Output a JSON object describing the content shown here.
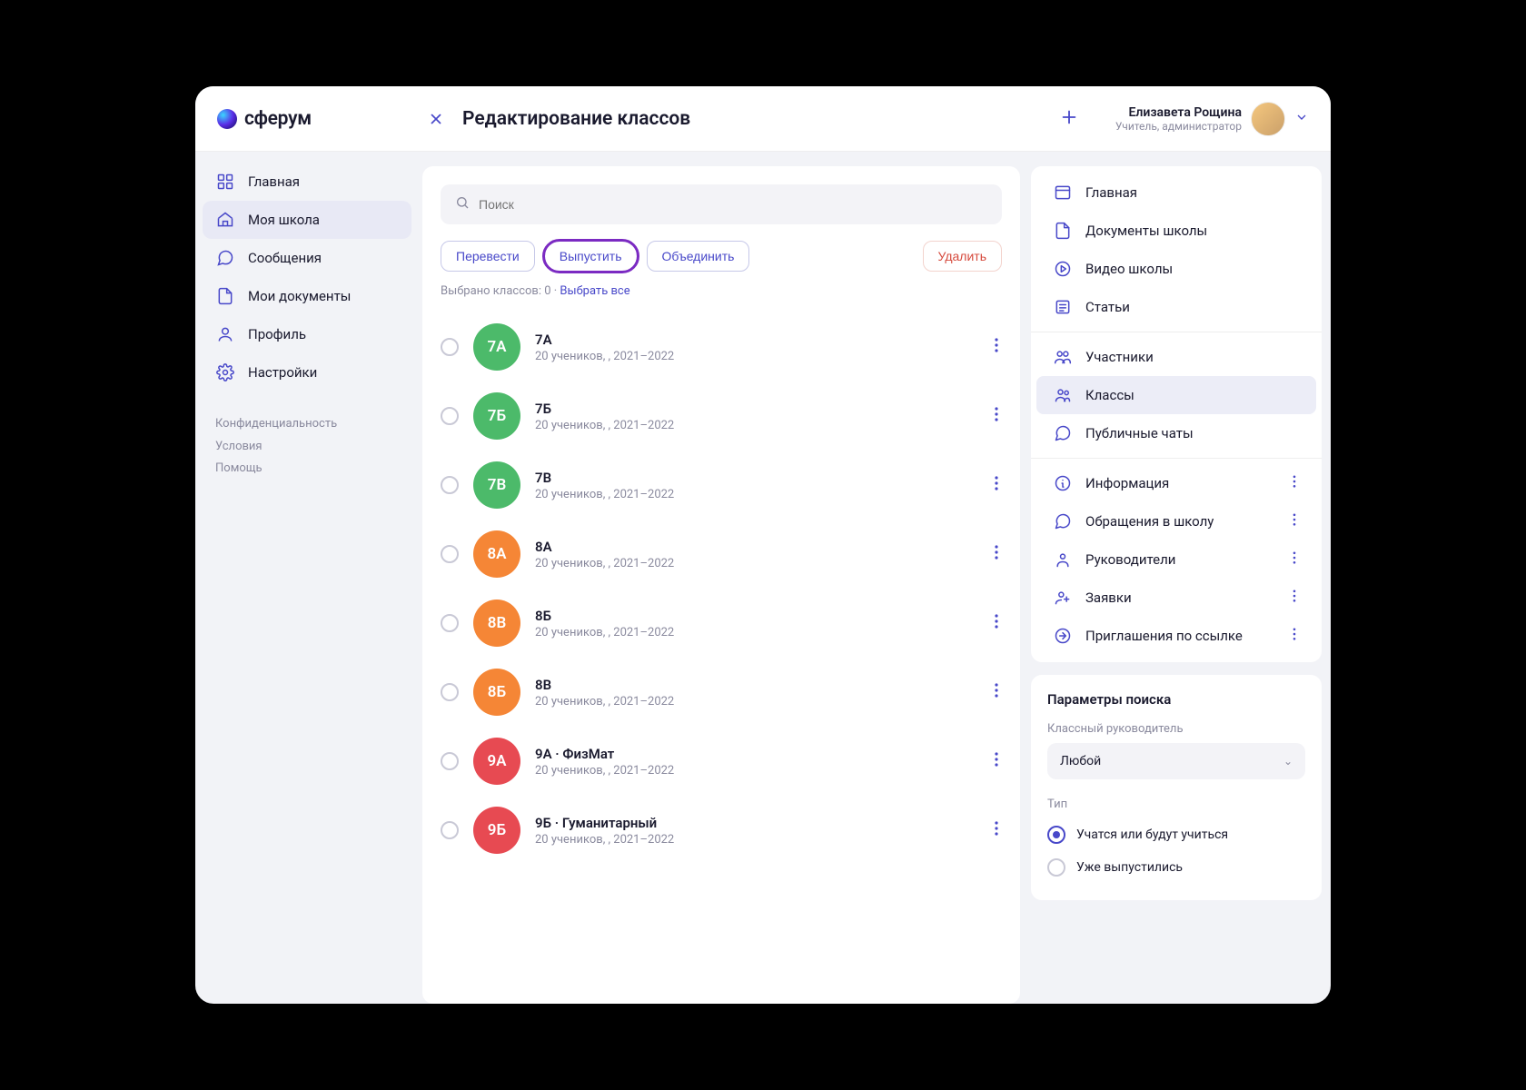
{
  "brand": "сферум",
  "header": {
    "title": "Редактирование классов",
    "user_name": "Елизавета Рощина",
    "user_role": "Учитель, администратор"
  },
  "sidebar": {
    "items": [
      {
        "label": "Главная"
      },
      {
        "label": "Моя школа"
      },
      {
        "label": "Сообщения"
      },
      {
        "label": "Мои документы"
      },
      {
        "label": "Профиль"
      },
      {
        "label": "Настройки"
      }
    ],
    "links": {
      "privacy": "Конфиденциальность",
      "terms": "Условия",
      "help": "Помощь"
    }
  },
  "search": {
    "placeholder": "Поиск"
  },
  "actions": {
    "transfer": "Перевести",
    "release": "Выпустить",
    "merge": "Объединить",
    "delete": "Удалить"
  },
  "selection": {
    "text": "Выбрано классов: 0 · ",
    "select_all": "Выбрать все"
  },
  "classes": [
    {
      "badge": "7А",
      "color": "green",
      "title": "7А",
      "sub": "20 учеников, , 2021–2022"
    },
    {
      "badge": "7Б",
      "color": "green",
      "title": "7Б",
      "sub": "20 учеников, , 2021–2022"
    },
    {
      "badge": "7В",
      "color": "green",
      "title": "7В",
      "sub": "20 учеников, , 2021–2022"
    },
    {
      "badge": "8А",
      "color": "orange",
      "title": "8А",
      "sub": "20 учеников, , 2021–2022"
    },
    {
      "badge": "8В",
      "color": "orange",
      "title": "8Б",
      "sub": "20 учеников, , 2021–2022"
    },
    {
      "badge": "8Б",
      "color": "orange",
      "title": "8В",
      "sub": "20 учеников, , 2021–2022"
    },
    {
      "badge": "9А",
      "color": "red",
      "title": "9А · ФизМат",
      "sub": "20 учеников, , 2021–2022"
    },
    {
      "badge": "9Б",
      "color": "red",
      "title": "9Б · Гуманитарный",
      "sub": "20 учеников, , 2021–2022"
    }
  ],
  "right_nav": {
    "g1": [
      {
        "label": "Главная",
        "icon": "window"
      },
      {
        "label": "Документы школы",
        "icon": "doc"
      },
      {
        "label": "Видео школы",
        "icon": "play"
      },
      {
        "label": "Статьи",
        "icon": "article"
      }
    ],
    "g2": [
      {
        "label": "Участники",
        "icon": "users"
      },
      {
        "label": "Классы",
        "icon": "group",
        "active": true
      },
      {
        "label": "Публичные чаты",
        "icon": "chat"
      }
    ],
    "g3": [
      {
        "label": "Информация",
        "icon": "info"
      },
      {
        "label": "Обращения в школу",
        "icon": "appeal"
      },
      {
        "label": "Руководители",
        "icon": "leader"
      },
      {
        "label": "Заявки",
        "icon": "request"
      },
      {
        "label": "Приглашения по ссылке",
        "icon": "invite"
      }
    ]
  },
  "params": {
    "title": "Параметры поиска",
    "teacher_label": "Классный руководитель",
    "teacher_value": "Любой",
    "type_label": "Тип",
    "type_options": [
      {
        "label": "Учатся или будут учиться",
        "checked": true
      },
      {
        "label": "Уже выпустились",
        "checked": false
      }
    ]
  }
}
